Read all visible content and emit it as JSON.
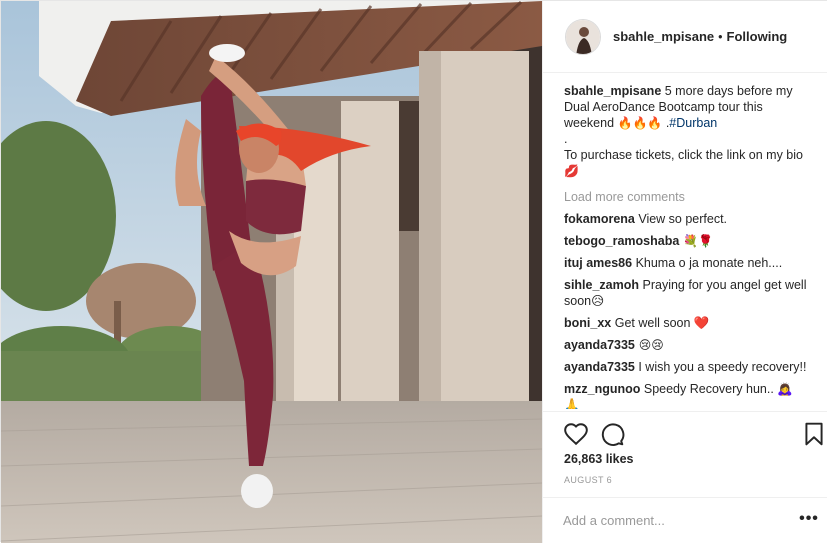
{
  "post": {
    "username": "sbahle_mpisane",
    "follow_separator": "•",
    "follow_label": "Following",
    "caption": {
      "username": "sbahle_mpisane",
      "text": " 5 more days before my Dual AeroDance Bootcamp tour this weekend ",
      "emojis": "🔥🔥🔥",
      "separator": " .",
      "hashtag": "#Durban",
      "dot": ".",
      "text2": "To purchase tickets, click the link on my bio",
      "emoji2": "💋"
    },
    "load_more": "Load more comments",
    "comments": [
      {
        "user": "fokamorena",
        "text": " View so perfect."
      },
      {
        "user": "tebogo_ramoshaba",
        "text": " 💐🌹"
      },
      {
        "user": "ituj ames86",
        "text": " Khuma o ja monate neh...."
      },
      {
        "user": "sihle_zamoh",
        "text": " Praying for you angel get well soon😥"
      },
      {
        "user": "boni_xx",
        "text": " Get well soon ❤️"
      },
      {
        "user": "ayanda7335",
        "text": " 😢😢"
      },
      {
        "user": "ayanda7335",
        "text": " I wish you a speedy recovery!!"
      },
      {
        "user": "mzz_ngunoo",
        "text": " Speedy Recovery hun.. 🙇‍♀️🙏"
      }
    ],
    "likes": "26,863 likes",
    "date": "AUGUST 6",
    "add_comment_placeholder": "Add a comment...",
    "more_options": "•••"
  },
  "icons": {
    "like": "heart-icon",
    "comment": "comment-icon",
    "save": "bookmark-icon",
    "more": "more-options-icon"
  },
  "colors": {
    "text": "#262626",
    "muted": "#999999",
    "hashtag": "#003569",
    "border": "#efefef"
  }
}
